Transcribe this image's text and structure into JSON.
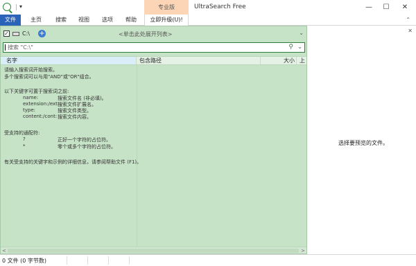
{
  "titlebar": {
    "edition_tab": "专业版",
    "app_title": "UltraSearch Free",
    "qa_arrow": "▾",
    "minimize": "—",
    "maximize": "☐",
    "close": "✕"
  },
  "ribbon": {
    "tabs": [
      "文件",
      "主页",
      "搜索",
      "视图",
      "选项",
      "帮助"
    ],
    "upgrade": "立即升级(U)!",
    "collapse": "⌃"
  },
  "drivebar": {
    "checked": "✓",
    "drive": "C:\\",
    "add": "+",
    "expand_hint": "<单击此处展开列表>",
    "dropdown": "⌄"
  },
  "search": {
    "placeholder": "搜索 \"C:\\\"",
    "button": "⚲",
    "dropdown": "⌄"
  },
  "columns": [
    "名字",
    "包含路径",
    "大小",
    "上"
  ],
  "help": {
    "intro1": "请输入搜索词开始搜索。",
    "intro2": "多个搜索词可以与用\"AND\"或\"OR\"组合。",
    "kw_title": "以下关键字可置于搜索词之前:",
    "keywords": [
      {
        "k": "name:",
        "d": "搜索文件名 (非必填)。"
      },
      {
        "k": "extension:/ext:",
        "d": "搜索文件扩展名。"
      },
      {
        "k": "type:",
        "d": "搜索文件类型。"
      },
      {
        "k": "content:/cont:",
        "d": "搜索文件内容。"
      }
    ],
    "wc_title": "受支持的通配符:",
    "wildcards": [
      {
        "k": "?",
        "d": "正好一个字符的占位符。"
      },
      {
        "k": "*",
        "d": "零个或多个字符的占位符。"
      }
    ],
    "more": "有关受支持的关键字和示例的详细信息，请参阅帮助文件 (F1)。"
  },
  "scrollbar": {
    "left": "<",
    "right": ">"
  },
  "preview": {
    "message": "选择要预览的文件。",
    "close": "✕"
  },
  "status": {
    "text": "0 文件 (0 字节数)"
  }
}
